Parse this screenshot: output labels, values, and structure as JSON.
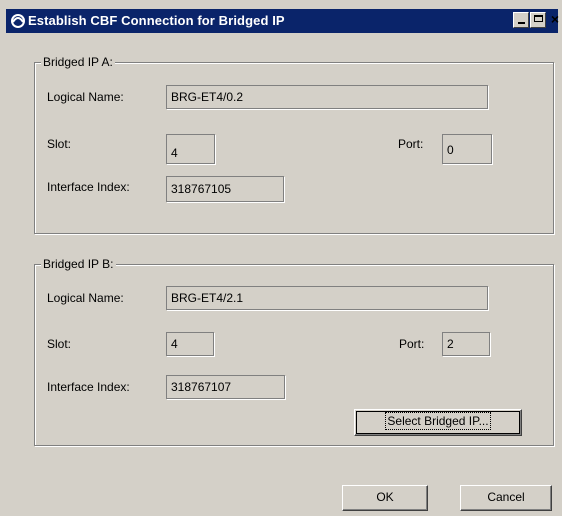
{
  "window": {
    "title": "Establish CBF Connection for Bridged IP",
    "controls": {
      "minimize": "_",
      "maximize": "□",
      "close": "×"
    }
  },
  "group_a": {
    "legend": "Bridged IP A:",
    "logical_name_label": "Logical Name:",
    "logical_name_value": "BRG-ET4/0.2",
    "slot_label": "Slot:",
    "slot_value": "4",
    "port_label": "Port:",
    "port_value": "0",
    "interface_index_label": "Interface Index:",
    "interface_index_value": "318767105"
  },
  "group_b": {
    "legend": "Bridged IP B:",
    "logical_name_label": "Logical Name:",
    "logical_name_value": "BRG-ET4/2.1",
    "slot_label": "Slot:",
    "slot_value": "4",
    "port_label": "Port:",
    "port_value": "2",
    "interface_index_label": "Interface Index:",
    "interface_index_value": "318767107",
    "select_button": "Select Bridged IP..."
  },
  "buttons": {
    "ok": "OK",
    "cancel": "Cancel"
  },
  "colors": {
    "titlebar": "#0a246a",
    "dialog_bg": "#d4d0c8"
  }
}
